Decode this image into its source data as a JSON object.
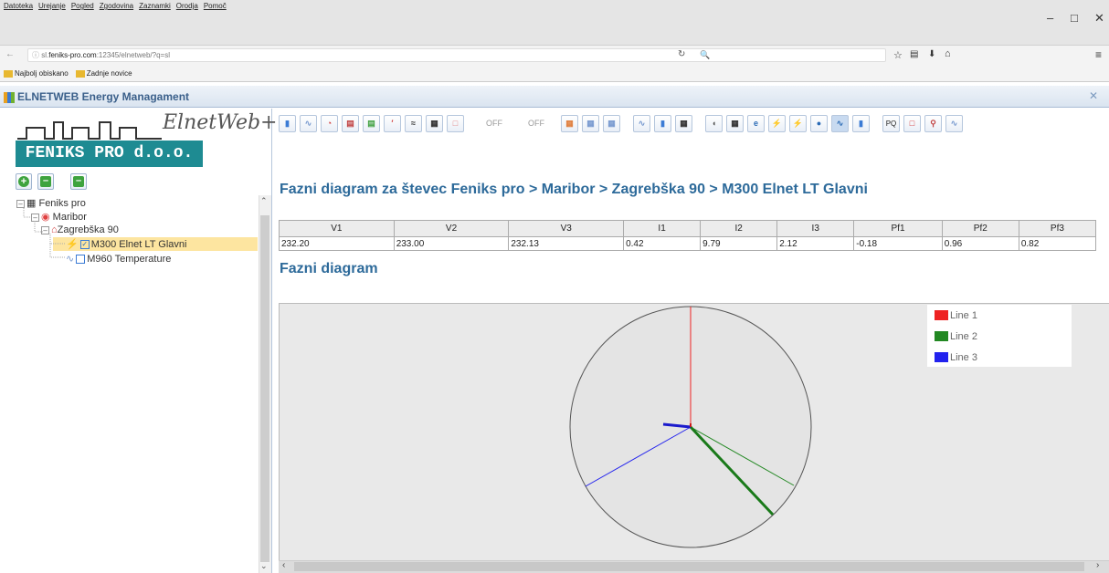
{
  "browser": {
    "menu": [
      "Datoteka",
      "Urejanje",
      "Pogled",
      "Zgodovina",
      "Zaznamki",
      "Orodja",
      "Pomoč"
    ],
    "url_prefix": "sl.",
    "url_host": "feniks-pro.com",
    "url_rest": ":12345/elnetweb/?q=sl",
    "search_placeholder": "🔍",
    "bookmarks": [
      "Najbolj obiskano",
      "Zadnje novice"
    ]
  },
  "app": {
    "title": "ELNETWEB Energy Managament",
    "logo_company": "FENIKS PRO d.o.o.",
    "logo_script": "ElnetWeb+"
  },
  "tree": [
    {
      "label": "Feniks pro",
      "depth": 0
    },
    {
      "label": "Maribor",
      "depth": 1
    },
    {
      "label": "Zagrebška 90",
      "depth": 2
    },
    {
      "label": "M300 Elnet LT Glavni",
      "depth": 3,
      "selected": true
    },
    {
      "label": "M960 Temperature",
      "depth": 3
    }
  ],
  "toolbar": {
    "off_label_1": "OFF",
    "off_label_2": "OFF",
    "pq_label": "PQ"
  },
  "page_title": "Fazni diagram za števec Feniks pro > Maribor > Zagrebška 90 > M300 Elnet LT Glavni",
  "table": {
    "headers": [
      "V1",
      "V2",
      "V3",
      "I1",
      "I2",
      "I3",
      "Pf1",
      "Pf2",
      "Pf3"
    ],
    "row": [
      "232.20",
      "233.00",
      "232.13",
      "0.42",
      "9.79",
      "2.12",
      "-0.18",
      "0.96",
      "0.82"
    ]
  },
  "section_title": "Fazni diagram",
  "legend": [
    {
      "name": "Line 1",
      "color": "#ee2222"
    },
    {
      "name": "Line 2",
      "color": "#228822"
    },
    {
      "name": "Line 3",
      "color": "#2222ee"
    }
  ]
}
